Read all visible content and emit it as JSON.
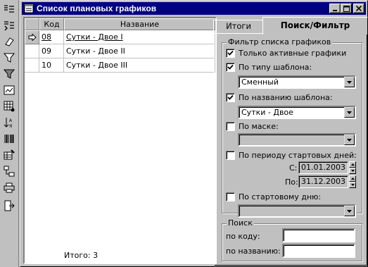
{
  "window": {
    "title": "Список плановых графиков"
  },
  "toolbar": {
    "icons": [
      "list-add-icon",
      "list-insert-icon",
      "eraser-icon",
      "filter-icon",
      "filter-clear-icon",
      "report-icon",
      "grid-settings-icon",
      "sort-icon",
      "barcode-icon",
      "edit-table-icon",
      "tree-icon",
      "print-icon",
      "exit-icon"
    ]
  },
  "grid": {
    "columns": [
      "Код",
      "Название"
    ],
    "rows": [
      {
        "code": "08",
        "name": "Сутки - Двое I",
        "selected": true
      },
      {
        "code": "09",
        "name": "Сутки - Двое II",
        "selected": false
      },
      {
        "code": "10",
        "name": "Сутки - Двое III",
        "selected": false
      }
    ],
    "total": "Итого: 3"
  },
  "tabs": {
    "items": [
      "Итоги",
      "Поиск/Фильтр"
    ],
    "active": "Поиск/Фильтр"
  },
  "filter": {
    "title": "Фильтр списка графиков",
    "only_active": {
      "label": "Только активные графики",
      "checked": true
    },
    "by_type": {
      "label": "По типу шаблона:",
      "checked": true,
      "value": "Сменный"
    },
    "by_name": {
      "label": "По названию шаблона:",
      "checked": true,
      "value": "Сутки - Двое"
    },
    "by_mask": {
      "label": "По маске:",
      "checked": false,
      "value": ""
    },
    "by_period": {
      "label": "По периоду стартовых дней:",
      "checked": false,
      "from_label": "С:",
      "from": "01.01.2003",
      "to_label": "По:",
      "to": "31.12.2003"
    },
    "by_start_day": {
      "label": "По стартовому дню:",
      "checked": false,
      "value": ""
    }
  },
  "search": {
    "title": "Поиск",
    "by_code_label": "по коду:",
    "by_code_value": "",
    "by_name_label": "по названию:",
    "by_name_value": ""
  }
}
